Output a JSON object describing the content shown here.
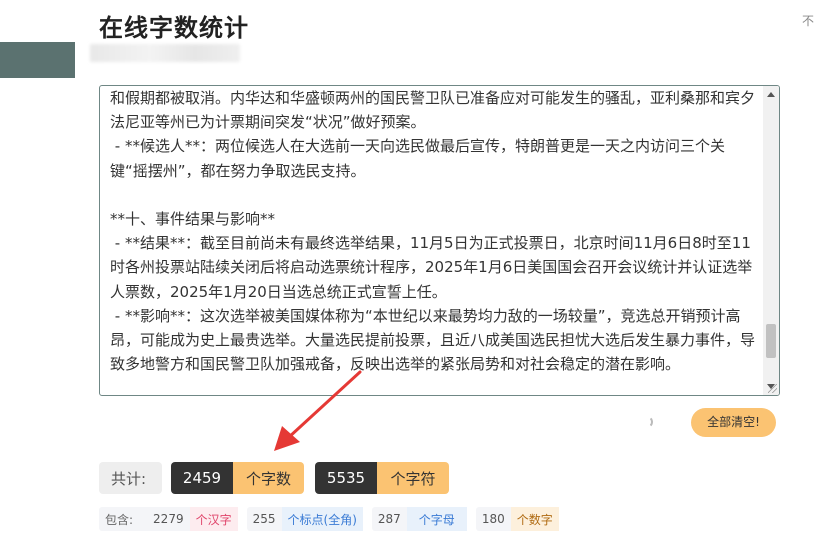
{
  "page": {
    "title": "在线字数统计",
    "corner_text": "不"
  },
  "editor": {
    "content": "和假期都被取消。内华达和华盛顿两州的国民警卫队已准备应对可能发生的骚乱，亚利桑那和宾夕法尼亚等州已为计票期间突发“状况”做好预案。\n - **候选人**：两位候选人在大选前一天向选民做最后宣传，特朗普更是一天之内访问三个关键“摇摆州”，都在努力争取选民支持。\n\n**十、事件结果与影响**\n - **结果**：截至目前尚未有最终选举结果，11月5日为正式投票日，北京时间11月6日8时至11时各州投票站陆续关闭后将启动选票统计程序，2025年1月6日美国国会召开会议统计并认证选举人票数，2025年1月20日当选总统正式宣誓上任。\n - **影响**：这次选举被美国媒体称为“本世纪以来最势均力敌的一场较量”，竞选总开销预计高昂，可能成为史上最贵选举。大量选民提前投票，且近八成美国选民担忧大选后发生暴力事件，导致多地警方和国民警卫队加强戒备，反映出选举的紧张局势和对社会稳定的潜在影响。"
  },
  "actions": {
    "clear_label": "全部清空!"
  },
  "stats": {
    "total_label": "共计:",
    "word_count": "2459",
    "word_unit": "个字数",
    "char_count": "5535",
    "char_unit": "个字符"
  },
  "details": {
    "label": "包含:",
    "items": [
      {
        "value": "2279",
        "unit": "个汉字",
        "color": "#e0456b",
        "bg": "#fdecef"
      },
      {
        "value": "255",
        "unit": "个标点(全角)",
        "color": "#3a7bd5",
        "bg": "#e8f1fb"
      },
      {
        "value": "287",
        "unit": "个字母",
        "color": "#3a7bd5",
        "bg": "#e8f1fb"
      },
      {
        "value": "180",
        "unit": "个数字",
        "color": "#b06b12",
        "bg": "#fdf0dc"
      }
    ]
  }
}
